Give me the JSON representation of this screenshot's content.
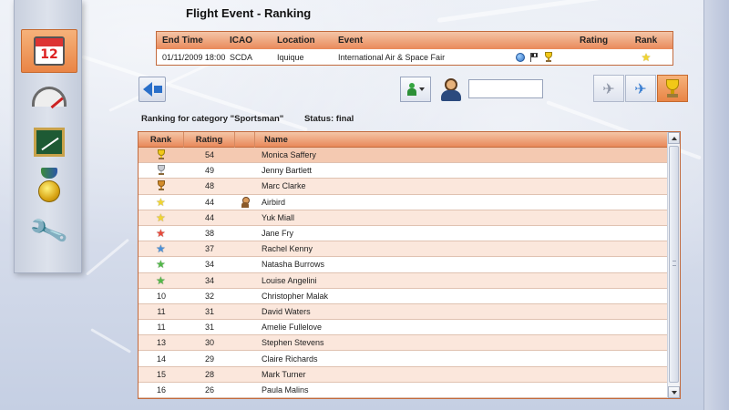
{
  "page": {
    "title": "Flight Event  -  Ranking"
  },
  "sidebar": {
    "items": [
      {
        "name": "calendar",
        "icon": "calendar-icon",
        "label": "12",
        "active": true
      },
      {
        "name": "gauge",
        "icon": "gauge-icon",
        "active": false
      },
      {
        "name": "chart",
        "icon": "chart-board-icon",
        "active": false
      },
      {
        "name": "medal",
        "icon": "medal-icon",
        "active": false
      },
      {
        "name": "tools",
        "icon": "wrench-icon",
        "active": false
      }
    ]
  },
  "event": {
    "headers": {
      "end_time": "End Time",
      "icao": "ICAO",
      "location": "Location",
      "event": "Event",
      "rating": "Rating",
      "rank": "Rank"
    },
    "row": {
      "end_time": "01/11/2009 18:00",
      "icao": "SCDA",
      "location": "Iquique",
      "event": "International Air & Space Fair",
      "icons": [
        "globe-icon",
        "flag-icon",
        "trophy-icon"
      ],
      "rating": "",
      "rank_icon": "star-icon",
      "rank_color": "#f1d531"
    }
  },
  "toolbar": {
    "search_value": "",
    "search_placeholder": ""
  },
  "category": {
    "label": "Ranking for category \"Sportsman\"",
    "status": "Status: final"
  },
  "ranking": {
    "headers": {
      "rank": "Rank",
      "rating": "Rating",
      "flag": "",
      "name": "Name"
    },
    "rows": [
      {
        "rank": "",
        "rank_icon": "trophy",
        "color": "#f2c818",
        "rating": "54",
        "flag": "",
        "name": "Monica Saffery"
      },
      {
        "rank": "",
        "rank_icon": "trophy",
        "color": "#c9ccd3",
        "rating": "49",
        "flag": "",
        "name": "Jenny Bartlett"
      },
      {
        "rank": "",
        "rank_icon": "trophy",
        "color": "#d28b2a",
        "rating": "48",
        "flag": "",
        "name": "Marc Clarke"
      },
      {
        "rank": "",
        "rank_icon": "star",
        "color": "#f1d531",
        "rating": "44",
        "flag": "pilot",
        "name": "Airbird"
      },
      {
        "rank": "",
        "rank_icon": "star",
        "color": "#f1d531",
        "rating": "44",
        "flag": "",
        "name": "Yuk Miall"
      },
      {
        "rank": "",
        "rank_icon": "star",
        "color": "#e8493a",
        "rating": "38",
        "flag": "",
        "name": "Jane Fry"
      },
      {
        "rank": "",
        "rank_icon": "star",
        "color": "#4a90d9",
        "rating": "37",
        "flag": "",
        "name": "Rachel Kenny"
      },
      {
        "rank": "",
        "rank_icon": "star",
        "color": "#52b848",
        "rating": "34",
        "flag": "",
        "name": "Natasha Burrows"
      },
      {
        "rank": "",
        "rank_icon": "star",
        "color": "#52b848",
        "rating": "34",
        "flag": "",
        "name": "Louise Angelini"
      },
      {
        "rank": "10",
        "rank_icon": "",
        "color": "",
        "rating": "32",
        "flag": "",
        "name": "Christopher Malak"
      },
      {
        "rank": "11",
        "rank_icon": "",
        "color": "",
        "rating": "31",
        "flag": "",
        "name": "David Waters"
      },
      {
        "rank": "11",
        "rank_icon": "",
        "color": "",
        "rating": "31",
        "flag": "",
        "name": "Amelie Fullelove"
      },
      {
        "rank": "13",
        "rank_icon": "",
        "color": "",
        "rating": "30",
        "flag": "",
        "name": "Stephen Stevens"
      },
      {
        "rank": "14",
        "rank_icon": "",
        "color": "",
        "rating": "29",
        "flag": "",
        "name": "Claire Richards"
      },
      {
        "rank": "15",
        "rank_icon": "",
        "color": "",
        "rating": "28",
        "flag": "",
        "name": "Mark Turner"
      },
      {
        "rank": "16",
        "rank_icon": "",
        "color": "",
        "rating": "26",
        "flag": "",
        "name": "Paula Malins"
      }
    ]
  },
  "colors": {
    "accent": "#e98546",
    "header_border": "#c26a3d",
    "row_alt": "#fbe7dc"
  }
}
